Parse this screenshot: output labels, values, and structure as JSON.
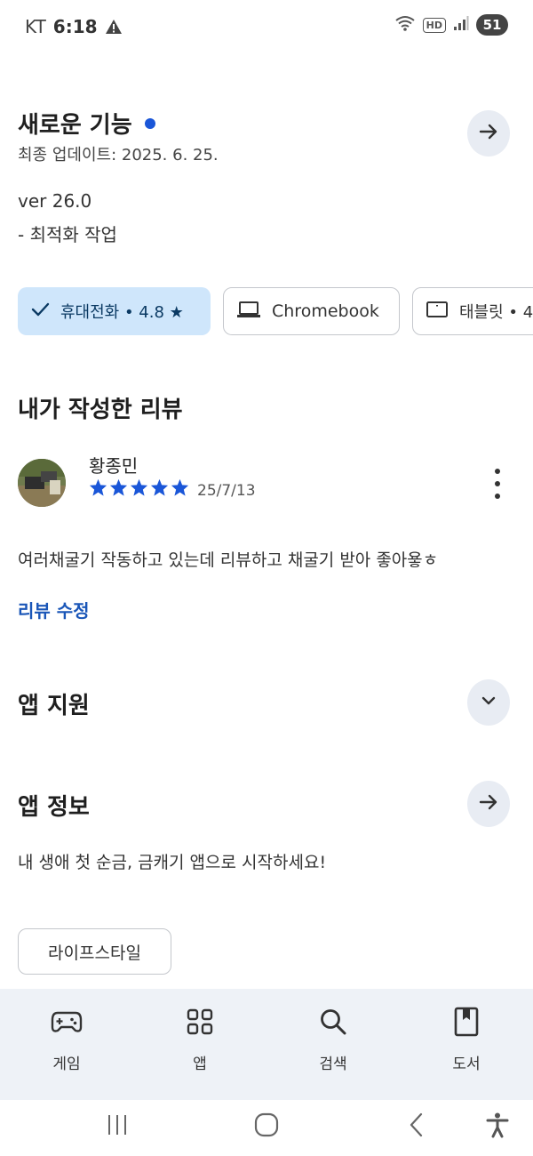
{
  "status_bar": {
    "carrier": "KT",
    "time": "6:18",
    "hd_label": "HD",
    "battery_level": "51"
  },
  "whats_new": {
    "title": "새로운 기능",
    "updated": "최종 업데이트: 2025. 6. 25.",
    "version": "ver 26.0",
    "note": "- 최적화 작업"
  },
  "device_chips": {
    "phone": {
      "label": "휴대전화 • 4.8 ★",
      "selected": true
    },
    "chromebook": {
      "label": "Chromebook"
    },
    "tablet": {
      "label": "태블릿 • 4"
    }
  },
  "my_review": {
    "section_title": "내가 작성한 리뷰",
    "reviewer": "황종민",
    "rating": 5,
    "date": "25/7/13",
    "text": "여러채굴기 작동하고 있는데 리뷰하고 채굴기 받아 좋아욯ㅎ",
    "edit_label": "리뷰 수정"
  },
  "app_support": {
    "title": "앱 지원"
  },
  "app_info": {
    "title": "앱 정보",
    "description": "내 생애 첫 순금, 금캐기 앱으로 시작하세요!",
    "category": "라이프스타일"
  },
  "bottom_nav": {
    "items": [
      {
        "label": "게임",
        "icon": "gamepad-icon"
      },
      {
        "label": "앱",
        "icon": "apps-grid-icon"
      },
      {
        "label": "검색",
        "icon": "search-icon"
      },
      {
        "label": "도서",
        "icon": "book-icon"
      }
    ]
  },
  "colors": {
    "accent_blue": "#1a56d8",
    "chip_selected_bg": "#cfe6fb",
    "star_blue": "#1a56d8",
    "nav_bg": "#eef2f7"
  }
}
